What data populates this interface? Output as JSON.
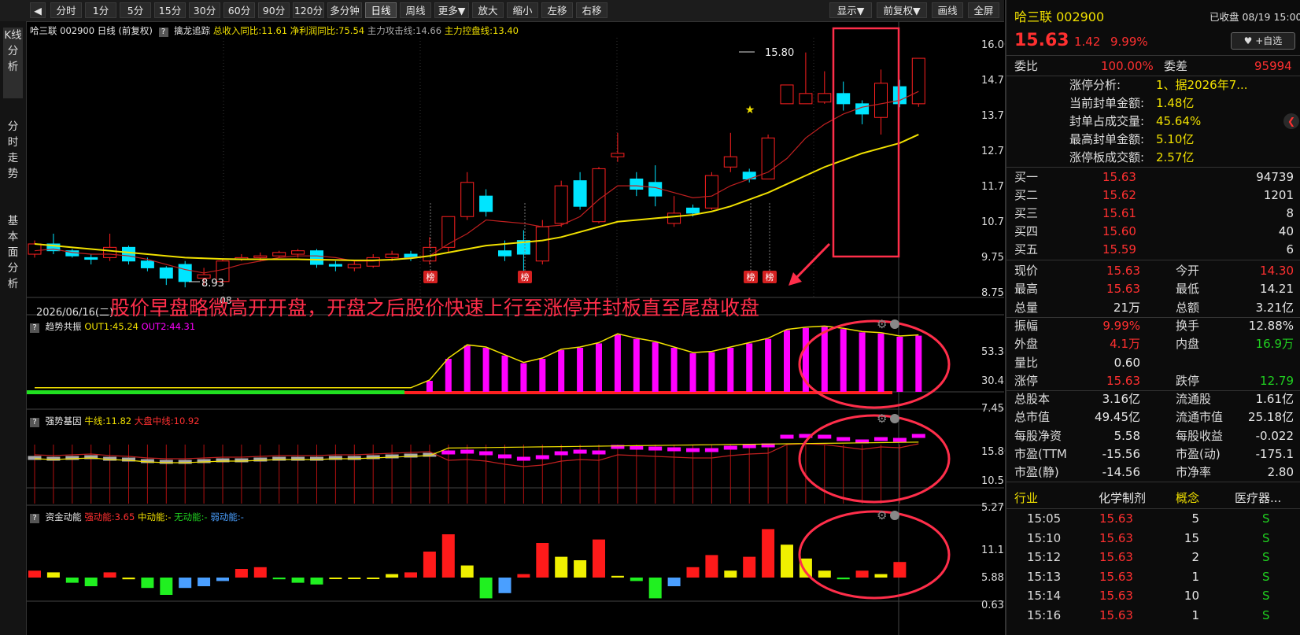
{
  "toolbar": {
    "items": [
      "分时",
      "1分",
      "5分",
      "15分",
      "30分",
      "60分",
      "90分",
      "120分",
      "多分钟",
      "日线",
      "周线",
      "更多▼",
      "放大",
      "缩小",
      "左移",
      "右移"
    ],
    "active": "日线",
    "right_items": [
      "显示▼",
      "前复权▼",
      "画线",
      "全屏"
    ]
  },
  "sidebar": {
    "tabs": [
      "K线分析",
      "分时走势",
      "基本面分析"
    ]
  },
  "chart": {
    "header": {
      "stock": "哈三联 002900 日线",
      "adjust": "(前复权)",
      "indicator_name": "擒龙追踪",
      "ind1": "总收入同比:11.61",
      "ind2": "净利润同比:75.54",
      "ind3": "主力攻击线:14.66",
      "ind4": "主力控盘线:13.40"
    },
    "price_axis": [
      "16.00",
      "14.75",
      "13.75",
      "12.75",
      "11.75",
      "10.75",
      "9.75",
      "8.75"
    ],
    "high_label": "15.80",
    "low_label": "8.93",
    "date_label": "2026/06/16(二)",
    "month_label": "08",
    "bang_label": "榜",
    "annotation": "股价早盘略微高开开盘，开盘之后股价快速上行至涨停并封板直至尾盘收盘",
    "panel1": {
      "name": "趋势共振",
      "out1": "OUT1:45.24",
      "out2": "OUT2:44.31",
      "axis": [
        "53.38",
        "30.42",
        "7.45"
      ]
    },
    "panel2": {
      "name": "强势基因",
      "l1": "牛线:11.82",
      "l2": "大盘中线:10.92",
      "axis": [
        "15.80",
        "10.53",
        "5.27"
      ]
    },
    "panel3": {
      "name": "资金动能",
      "l1": "强动能:3.65",
      "l2": "中动能:-",
      "l3": "无动能:-",
      "l4": "弱动能:-",
      "axis": [
        "11.12",
        "5.88",
        "0.63"
      ]
    },
    "colors": {
      "up": "#ff2020",
      "down": "#00e5ff",
      "ma": "#f0e000",
      "magenta": "#ff00ff",
      "annotation": "#ff2e4a"
    }
  },
  "quote": {
    "name": "哈三联 002900",
    "status": "已收盘 08/19 15:00",
    "price": "15.63",
    "change": "1.42",
    "pct": "9.99%",
    "watch_btn": "♥ +自选",
    "weibi_label": "委比",
    "weibi": "100.00%",
    "weicha_label": "委差",
    "weicha": "95994",
    "limit_analysis": [
      {
        "k": "涨停分析:",
        "v": "1、据2026年7..."
      },
      {
        "k": "当前封单金额:",
        "v": "1.48亿"
      },
      {
        "k": "封单占成交量:",
        "v": "45.64%"
      },
      {
        "k": "最高封单金额:",
        "v": "5.10亿"
      },
      {
        "k": "涨停板成交额:",
        "v": "2.57亿"
      }
    ],
    "buys": [
      {
        "k": "买一",
        "p": "15.63",
        "v": "94739"
      },
      {
        "k": "买二",
        "p": "15.62",
        "v": "1201"
      },
      {
        "k": "买三",
        "p": "15.61",
        "v": "8"
      },
      {
        "k": "买四",
        "p": "15.60",
        "v": "40"
      },
      {
        "k": "买五",
        "p": "15.59",
        "v": "6"
      }
    ],
    "stats": [
      {
        "k1": "现价",
        "v1": "15.63",
        "c1": "red",
        "k2": "今开",
        "v2": "14.30",
        "c2": "red"
      },
      {
        "k1": "最高",
        "v1": "15.63",
        "c1": "red",
        "k2": "最低",
        "v2": "14.21",
        "c2": "white"
      },
      {
        "k1": "总量",
        "v1": "21万",
        "c1": "white",
        "k2": "总额",
        "v2": "3.21亿",
        "c2": "white"
      },
      {
        "k1": "振幅",
        "v1": "9.99%",
        "c1": "red",
        "k2": "换手",
        "v2": "12.88%",
        "c2": "white"
      },
      {
        "k1": "外盘",
        "v1": "4.1万",
        "c1": "red",
        "k2": "内盘",
        "v2": "16.9万",
        "c2": "green"
      },
      {
        "k1": "量比",
        "v1": "0.60",
        "c1": "white",
        "k2": "",
        "v2": "",
        "c2": "white"
      },
      {
        "k1": "涨停",
        "v1": "15.63",
        "c1": "red",
        "k2": "跌停",
        "v2": "12.79",
        "c2": "green"
      },
      {
        "k1": "总股本",
        "v1": "3.16亿",
        "c1": "white",
        "k2": "流通股",
        "v2": "1.61亿",
        "c2": "white"
      },
      {
        "k1": "总市值",
        "v1": "49.45亿",
        "c1": "white",
        "k2": "流通市值",
        "v2": "25.18亿",
        "c2": "white"
      },
      {
        "k1": "每股净资",
        "v1": "5.58",
        "c1": "white",
        "k2": "每股收益",
        "v2": "-0.022",
        "c2": "white"
      },
      {
        "k1": "市盈(TTM",
        "v1": "-15.56",
        "c1": "white",
        "k2": "市盈(动)",
        "v2": "-175.1",
        "c2": "white"
      },
      {
        "k1": "市盈(静)",
        "v1": "-14.56",
        "c1": "white",
        "k2": "市净率",
        "v2": "2.80",
        "c2": "white"
      }
    ],
    "industry_label": "行业",
    "industry": "化学制剂",
    "concept_label": "概念",
    "concept": "医疗器...",
    "ticks": [
      {
        "t": "15:05",
        "p": "15.63",
        "v": "5",
        "s": "S"
      },
      {
        "t": "15:10",
        "p": "15.63",
        "v": "15",
        "s": "S"
      },
      {
        "t": "15:12",
        "p": "15.63",
        "v": "2",
        "s": "S"
      },
      {
        "t": "15:13",
        "p": "15.63",
        "v": "1",
        "s": "S"
      },
      {
        "t": "15:14",
        "p": "15.63",
        "v": "10",
        "s": "S"
      },
      {
        "t": "15:16",
        "p": "15.63",
        "v": "1",
        "s": "S"
      }
    ]
  }
}
